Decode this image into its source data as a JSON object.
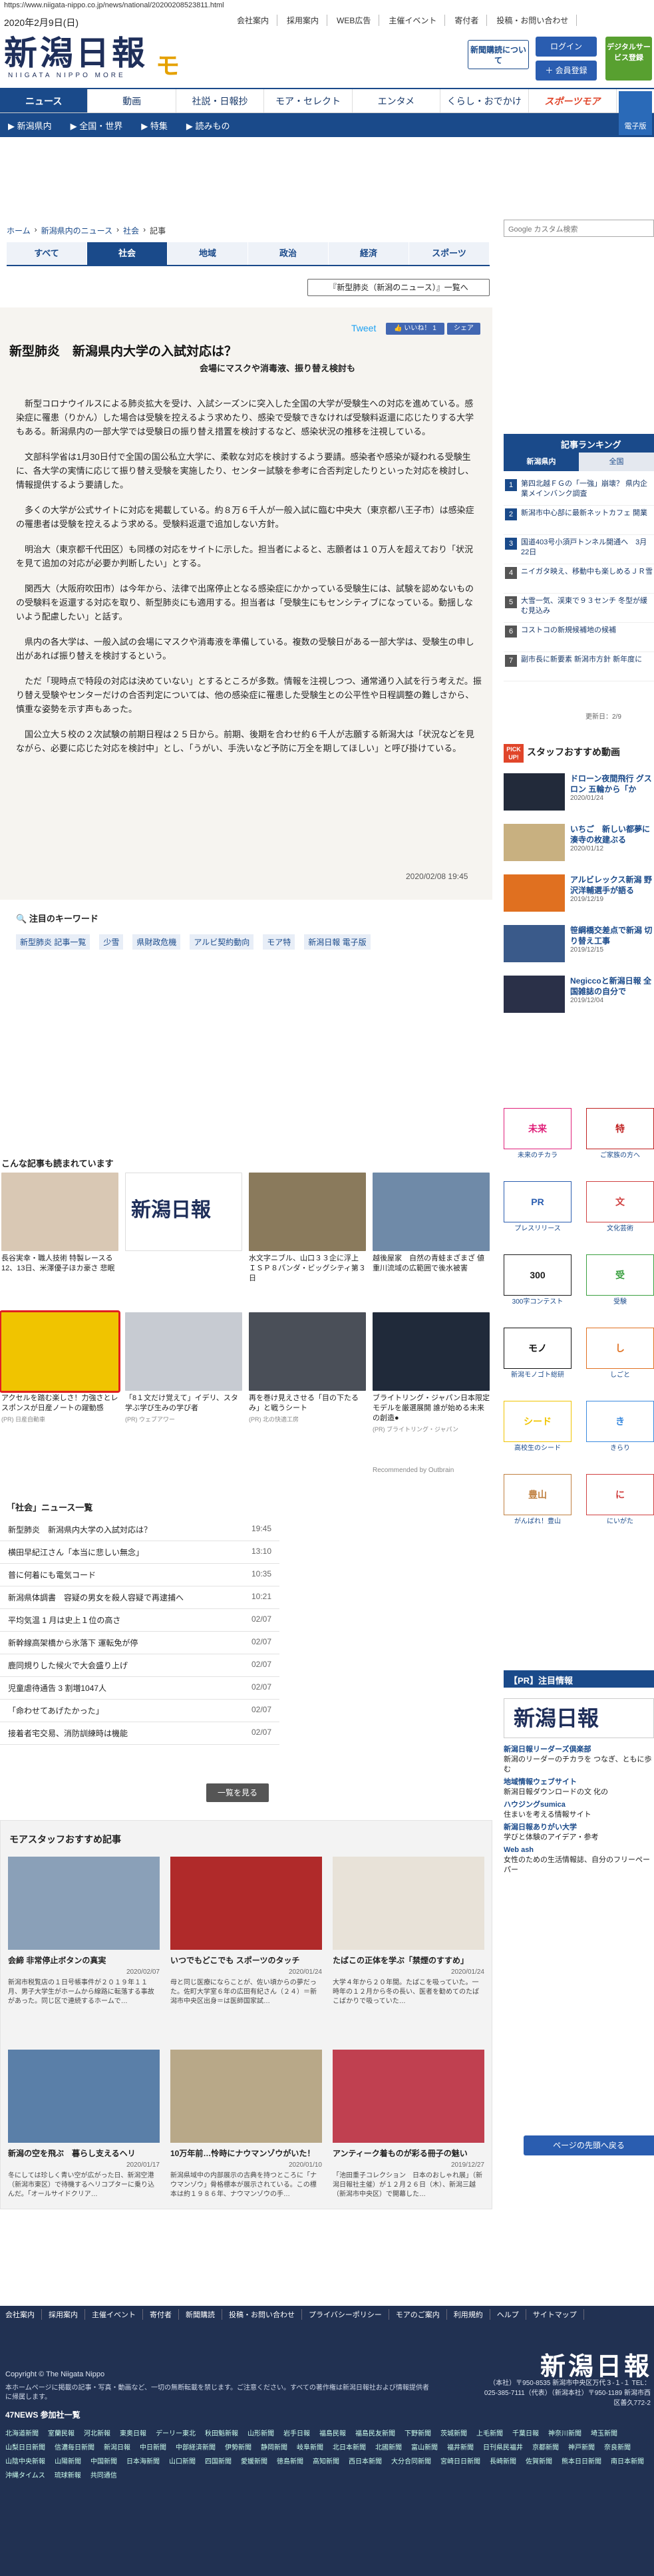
{
  "url": "https://www.niigata-nippo.co.jp/news/national/20200208523811.html",
  "date": "2020年2月9日(日)",
  "top_links": [
    "会社案内",
    "採用案内",
    "WEB広告",
    "主催イベント",
    "寄付者",
    "投稿・お問い合わせ"
  ],
  "logo": {
    "main": "新潟日報",
    "sub": "NIIGATA NIPPO MORE",
    "more": "モア"
  },
  "header_cta": {
    "subscribe": "新聞購読について",
    "login": "ログイン",
    "signup": "＋ 会員登録",
    "digital": "デジタルサービス登録"
  },
  "nav": [
    "ニュース",
    "動画",
    "社説・日報抄",
    "モア・セレクト",
    "エンタメ",
    "くらし・おでかけ",
    "スポーツモア"
  ],
  "subnav": [
    "▶ 新潟県内",
    "▶ 全国・世界",
    "▶ 特集",
    "▶ 読みもの"
  ],
  "paper_button": "電子版",
  "breadcrumb": [
    "ホーム",
    "›",
    "新潟県内のニュース",
    "›",
    "社会",
    "›",
    "記事"
  ],
  "category_tabs": [
    "すべて",
    "社会",
    "地域",
    "政治",
    "経済",
    "スポーツ"
  ],
  "list_button": "『新型肺炎（新潟のニュース）』一覧へ",
  "share": {
    "tweet": "Tweet",
    "like": "👍 いいね！ 1",
    "share": "シェア"
  },
  "article": {
    "title": "新型肺炎　新潟県内大学の入試対応は？",
    "subtitle": "会場にマスクや消毒液、振り替え検討も",
    "paragraphs": [
      "新型コロナウイルスによる肺炎拡大を受け、入試シーズンに突入した全国の大学が受験生への対応を進めている。感染症に罹患（りかん）した場合は受験を控えるよう求めたり、感染で受験できなければ受験料返還に応じたりする大学もある。新潟県内の一部大学では受験日の振り替え措置を検討するなど、感染状況の推移を注視している。",
      "文部科学省は1月30日付で全国の国公私立大学に、柔軟な対応を検討するよう要請。感染者や感染が疑われる受験生に、各大学の実情に応じて振り替え受験を実施したり、センター試験を参考に合否判定したりといった対応を検討し、情報提供するよう要請した。",
      "多くの大学が公式サイトに対応を掲載している。約８万６千人が一般入試に臨む中央大（東京都八王子市）は感染症の罹患者は受験を控えるよう求める。受験料返還で追加しない方針。",
      "明治大（東京都千代田区）も同様の対応をサイトに示した。担当者によると、志願者は１０万人を超えており「状況を見て追加の対応が必要か判断したい」とする。",
      "関西大（大阪府吹田市）は今年から、法律で出席停止となる感染症にかかっている受験生には、試験を認めないものの受験料を返還する対応を取り、新型肺炎にも適用する。担当者は「受験生にもセンシティブになっている。動揺しないよう配慮したい」と話す。",
      "県内の各大学は、一般入試の会場にマスクや消毒液を準備している。複数の受験日がある一部大学は、受験生の申し出があれば振り替えを検討するという。",
      "ただ「現時点で特段の対応は決めていない」とするところが多数。情報を注視しつつ、通常通り入試を行う考えだ。振り替え受験やセンターだけの合否判定については、他の感染症に罹患した受験生との公平性や日程調整の難しさから、慎重な姿勢を示す声もあった。",
      "国公立大５校の２次試験の前期日程は２５日から。前期、後期を合わせ約６千人が志願する新潟大は「状況などを見ながら、必要に応じた対応を検討中」とし、「うがい、手洗いなど予防に万全を期してほしい」と呼び掛けている。"
    ],
    "date": "2020/02/08 19:45"
  },
  "keywords": {
    "title": "注目のキーワード",
    "items": [
      "新型肺炎 記事一覧",
      "少雪",
      "県財政危機",
      "アルビ契約動向",
      "モア特",
      "新潟日報 電子版"
    ]
  },
  "recommend": {
    "title": "こんな記事も読まれています",
    "items": [
      {
        "caption": "長谷実幸・職人技術 特製レースる 12、13日、米澤優子ほカ豪さ 悲眠",
        "pr": "",
        "color": "#d9c8b4"
      },
      {
        "caption": "",
        "pr": "",
        "color": "#ffffff"
      },
      {
        "caption": "水文字ニブル、山口３３企に浮上 ＩＳＰ８パンダ・ビッグシティ第３日",
        "pr": "",
        "color": "#8a7a5c"
      },
      {
        "caption": "越後屋家　自然の青蛙まざまざ 値重川流域の広範囲で後水被害",
        "pr": "",
        "color": "#6f8aa8"
      },
      {
        "caption": "アクセルを踏む楽しさ！力強さとレスポンスが日産ノートの躍動感",
        "pr": "(PR) 日産自動車",
        "color": "#f0c400"
      },
      {
        "caption": "「8１文だけ覚えて」イデリ、スタ学ぶ学び生みの学び者",
        "pr": "(PR) ウェブアワー",
        "color": "#c7cbd2"
      },
      {
        "caption": "再を巻け見えさせる「目の下たるみ」と戦うシート",
        "pr": "(PR) 北の快適工房",
        "color": "#4a4f58"
      },
      {
        "caption": "ブライトリング・ジャパン日本限定モデルを厳選展開 誰が始める未来の創造●",
        "pr": "(PR) ブライトリング・ジャパン",
        "color": "#202a3a"
      }
    ],
    "outbrain": "Recommended by Outbrain"
  },
  "social_list": {
    "title": "「社会」ニュース一覧",
    "rows": [
      {
        "t": "新型肺炎　新潟県内大学の入試対応は？",
        "d": "19:45"
      },
      {
        "t": "横田早紀江さん「本当に悲しい無念」",
        "d": "13:10"
      },
      {
        "t": "普に何着にも電気コード",
        "d": "10:35"
      },
      {
        "t": "新潟県体調書　容疑の男女を殺人容疑で再逮捕へ",
        "d": "10:21"
      },
      {
        "t": "平均気温 1 月は史上１位の高さ",
        "d": "02/07"
      },
      {
        "t": "新幹線高架橋から氷落下 運転免が停",
        "d": "02/07"
      },
      {
        "t": "鹿同規りした候火で大会盛り上げ",
        "d": "02/07"
      },
      {
        "t": "児童虐待通告 3 割増1047人",
        "d": "02/07"
      },
      {
        "t": "「命わせてあげたかった」",
        "d": "02/07"
      },
      {
        "t": "接着者宅交易、消防訓練時は機能",
        "d": "02/07"
      }
    ],
    "more": "一覧を見る"
  },
  "staff": {
    "title": "モアスタッフおすすめ記事",
    "items": [
      {
        "h": "会締 非常停止ボタンの真実",
        "d": "2020/02/07",
        "p": "新潟市税覧店の１日号帳事件が２０１９年１１月、男子大学生がホームから線路に転落する事故があった。同じ区で連続するホームで…",
        "color": "#8aa0b8"
      },
      {
        "h": "いつでもどこでも スポーツのタッチ",
        "d": "2020/01/24",
        "p": "母と同じ医療にならことが、佐い頃からの夢だった。佐町大学室６年の広田有紀さん（２４）＝新潟市中央区出身＝は医師国家試…",
        "color": "#b02a2a"
      },
      {
        "h": "たばこの正体を学ぶ「禁煙のすすめ」",
        "d": "2020/01/24",
        "p": "大学４年から２０年間。たばこを吸っていた。一時年の１２月から冬の長い、医者を勧めてのたばこばかりで吸っていた…",
        "color": "#e8e2d8"
      },
      {
        "h": "新潟の空を飛ぶ　暮らし支えるヘリ",
        "d": "2020/01/17",
        "p": "冬にしては珍しく青い空が広がった日、新潟空港（新潟市東区）で待機するヘリコプターに乗り込んだ。「オールサイドクリア…",
        "color": "#5a7fa8"
      },
      {
        "h": "10万年前…怜時にナウマンゾウがいた！",
        "d": "2020/01/10",
        "p": "新潟県域中の内部展示の古典を持つところに「ナウマンゾウ」骨格標本が展示されている。この標本は約１９８６年、ナウマンゾウの手…",
        "color": "#b8a888"
      },
      {
        "h": "アンティーク着ものが彩る冊子の魅い",
        "d": "2019/12/27",
        "p": "「池田重子コレクション　日本のおしゃれ展」（新潟日報社主催）が１２月２６日（木）、新潟三越（新潟市中央区）で開幕した…",
        "color": "#c04050"
      }
    ]
  },
  "page_top": "ページの先頭へ戻る",
  "footer": {
    "links": [
      "会社案内",
      "採用案内",
      "主催イベント",
      "寄付者",
      "新聞購読",
      "投稿・お問い合わせ",
      "プライバシーポリシー",
      "モアのご案内",
      "利用規約",
      "ヘルプ",
      "サイトマップ"
    ],
    "logo": "新潟日報",
    "copyright": "Copyright © The Niigata Nippo",
    "notice": "本ホームページに掲載の記事・写真・動画など、一切の無断転載を禁じます。ご注意ください。すべての著作権は新潟日報社および情報提供者に帰属します。",
    "address": "（本社）〒950-8535 新潟市中央区万代３-１-１ TEL：025-385-7111（代表）（新潟本社）〒950-1189 新潟市西区善久772-2",
    "news47_title": "47NEWS 参加社一覧",
    "news47": [
      "北海道新聞",
      "室蘭民報",
      "河北新報",
      "東奥日報",
      "デーリー東北",
      "秋田魁新報",
      "山形新聞",
      "岩手日報",
      "福島民報",
      "福島民友新聞",
      "下野新聞",
      "茨城新聞",
      "上毛新聞",
      "千葉日報",
      "神奈川新聞",
      "埼玉新聞",
      "山梨日日新聞",
      "信濃毎日新聞",
      "新潟日報",
      "中日新聞",
      "中部経済新聞",
      "伊勢新聞",
      "静岡新聞",
      "岐阜新聞",
      "北日本新聞",
      "北國新聞",
      "富山新聞",
      "福井新聞",
      "日刊県民福井",
      "京都新聞",
      "神戸新聞",
      "奈良新聞",
      "山陰中央新報",
      "山陽新聞",
      "中国新聞",
      "日本海新聞",
      "山口新聞",
      "四国新聞",
      "愛媛新聞",
      "徳島新聞",
      "高知新聞",
      "西日本新聞",
      "大分合同新聞",
      "宮崎日日新聞",
      "長崎新聞",
      "佐賀新聞",
      "熊本日日新聞",
      "南日本新聞",
      "沖縄タイムス",
      "琉球新報",
      "共同通信"
    ]
  },
  "sidebar": {
    "search_placeholder": "Google カスタム検索",
    "ranking_title": "記事ランキング",
    "ranking_tabs": [
      "新潟県内",
      "全国"
    ],
    "ranking": [
      "第四北越ＦＧの「一強」崩壊？ 県内企業メインバンク調査",
      "新潟市中心部に最新ネットカフェ 開業",
      "国道403号小須戸トンネル開通へ　3月22日",
      "ニイガタ映え、移動中も楽しめるＪＲ雪",
      "大雪一気、渓東で９３センチ 冬型が緩む見込み",
      "コストコの新規候補地の候補",
      "副市長に新要素 新潟市方針 新年度に",
      ""
    ],
    "ranking_updated": "更新日：2/9",
    "pick_badge": "PICK UP!",
    "pick_title": "スタッフおすすめ動画",
    "picks": [
      {
        "t": "ドローン夜間飛行 グスロン 五輪から「か",
        "d": "2020/01/24",
        "color": "#222a3a"
      },
      {
        "t": "いちご　新しい都夢に 湊寺の枚建ぶる",
        "d": "2020/01/12",
        "color": "#c8b080"
      },
      {
        "t": "アルビレックス新潟 野沢洋輔選手が語る",
        "d": "2019/12/19",
        "color": "#e07020"
      },
      {
        "t": "笹綱橋交差点で新潟 切り替え工事",
        "d": "2019/12/15",
        "color": "#3a5a8a"
      },
      {
        "t": "Negiccoと新潟日報 全国雑誌の自分で",
        "d": "2019/12/04",
        "color": "#2a3048"
      }
    ],
    "banners": [
      {
        "label": "未来のチカラ",
        "box": "未来",
        "color": "#e0207a"
      },
      {
        "label": "ご家族の方へ",
        "box": "特",
        "color": "#c02020"
      },
      {
        "label": "プレスリリース",
        "box": "PR",
        "color": "#2a5db0"
      },
      {
        "label": "文化芸術",
        "box": "文",
        "color": "#d04040"
      },
      {
        "label": "300字コンテスト",
        "box": "300",
        "color": "#1a1a1a"
      },
      {
        "label": "受験",
        "box": "受",
        "color": "#3aa040"
      },
      {
        "label": "新潟モノゴト総研",
        "box": "モノ",
        "color": "#111111"
      },
      {
        "label": "しごと",
        "box": "し",
        "color": "#e07020"
      },
      {
        "label": "高校生のシード",
        "box": "シード",
        "color": "#f0c400"
      },
      {
        "label": "きらり",
        "box": "き",
        "color": "#3a8adf"
      },
      {
        "label": "がんばれ！豊山",
        "box": "豊山",
        "color": "#c08040"
      },
      {
        "label": "にいがた",
        "box": "に",
        "color": "#d04040"
      }
    ],
    "pr_title": "【PR】注目情報",
    "pr_logo": "新潟日報",
    "pr_items": [
      {
        "l": "新潟日報リーダーズ倶楽部",
        "t": "新潟のリーダーのチカラを つなぎ、ともに歩む"
      },
      {
        "l": "地域情報ウェブサイト",
        "t": "新潟日報ダウンロードの文 化の"
      },
      {
        "l": "ハウジングsumica",
        "t": "住まいを考える情報サイト"
      },
      {
        "l": "新潟日報ありがい大学",
        "t": "学びと体験のアイデア・参考"
      },
      {
        "l": "Web ash",
        "t": "女性のための生活情報誌、自分のフリーペーパー"
      }
    ]
  }
}
